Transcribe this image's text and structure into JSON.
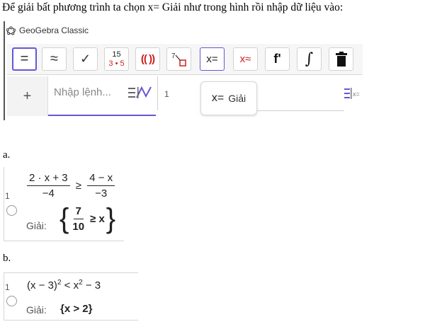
{
  "intro_text": "Để giải bất phương trình ta chọn x= Giải như trong hình rồi nhập dữ liệu vào:",
  "app": {
    "title": "GeoGebra Classic"
  },
  "toolbar": {
    "eval_symbol": "=",
    "approx_symbol": "≈",
    "check_symbol": "✓",
    "factor_top": "15",
    "factor_bottom": "3 • 5",
    "expand_symbol": "(( ))",
    "substitute_super": "7",
    "solve_symbol": "x=",
    "nsolve_symbol": "x≈",
    "derivative_symbol": "f'",
    "integral_symbol": "∫"
  },
  "algebra": {
    "plus_label": "+",
    "input_placeholder": "Nhập lệnh...",
    "row_number": "1"
  },
  "tooltip": {
    "icon": "x=",
    "label": "Giải"
  },
  "part_a": {
    "label": "a.",
    "row_number": "1",
    "lhs_num": "2 · x + 3",
    "lhs_den": "−4",
    "relation": "≥",
    "rhs_num": "4 − x",
    "rhs_den": "−3",
    "output_label": "Giải:",
    "result_num": "7",
    "result_den": "10",
    "result_rel": "≥ x"
  },
  "part_b": {
    "label": "b.",
    "row_number": "1",
    "expr_base": "(x − 3)",
    "expr_exp": "2",
    "expr_rel": " < x",
    "expr_exp2": "2",
    "expr_tail": " − 3",
    "output_label": "Giải:",
    "result": "{x > 2}"
  },
  "colors": {
    "accent": "#6557d2",
    "red": "#cc1f1f"
  }
}
